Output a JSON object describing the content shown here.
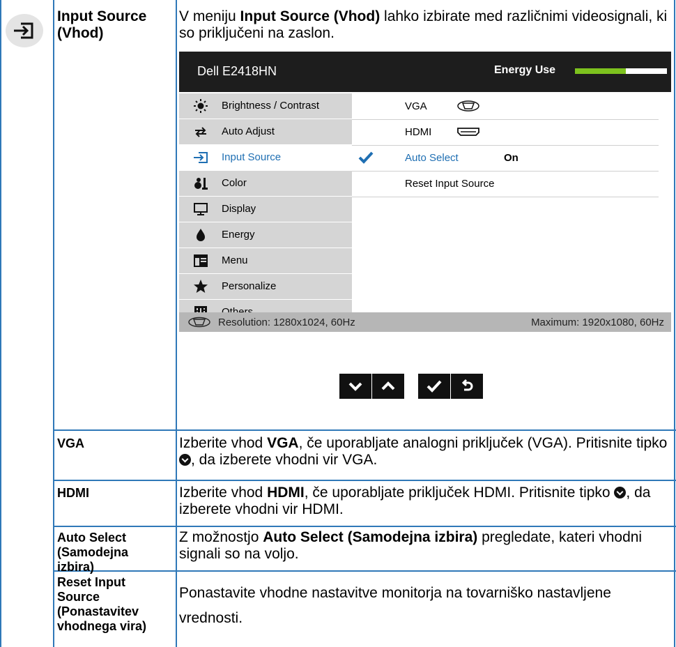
{
  "section": {
    "term_line1": "Input Source",
    "term_line2": "(Vhod)",
    "intro_pre": "V meniju ",
    "intro_bold": "Input Source (Vhod)",
    "intro_post": " lahko izbirate med različnimi videosignali, ki so priključeni na zaslon."
  },
  "osd": {
    "title": "Dell E2418HN",
    "energy_label": "Energy Use",
    "energy_level": 0.55,
    "menu": [
      {
        "label": "Brightness / Contrast",
        "icon": "brightness-icon"
      },
      {
        "label": "Auto Adjust",
        "icon": "auto-adjust-icon"
      },
      {
        "label": "Input Source",
        "icon": "input-source-icon"
      },
      {
        "label": "Color",
        "icon": "color-icon"
      },
      {
        "label": "Display",
        "icon": "display-icon"
      },
      {
        "label": "Energy",
        "icon": "energy-icon"
      },
      {
        "label": "Menu",
        "icon": "menu-icon"
      },
      {
        "label": "Personalize",
        "icon": "star-icon"
      },
      {
        "label": "Others",
        "icon": "others-icon"
      }
    ],
    "active_menu": "Input Source",
    "submenu": [
      {
        "label": "VGA",
        "icon": "vga-connector-icon"
      },
      {
        "label": "HDMI",
        "icon": "hdmi-connector-icon"
      },
      {
        "label": "Auto Select",
        "value": "On",
        "selected": true
      },
      {
        "label": "Reset Input Source"
      }
    ],
    "footer_left": "Resolution: 1280x1024, 60Hz",
    "footer_right": "Maximum: 1920x1080, 60Hz",
    "colors": {
      "accent": "#1f6fb3",
      "energy": "#7dc21e",
      "header": "#1d1d1d"
    }
  },
  "nav_buttons": [
    "chevron-down-icon",
    "chevron-up-icon",
    "check-icon",
    "back-icon"
  ],
  "rows": [
    {
      "term": "VGA",
      "desc_pre": "Izberite vhod ",
      "desc_bold": "VGA",
      "desc_mid": ", če uporabljate analogni priključek (VGA). Pritisnite tipko ",
      "desc_post": ", da izberete vhodni vir VGA."
    },
    {
      "term": "HDMI",
      "desc_pre": "Izberite vhod ",
      "desc_bold": "HDMI",
      "desc_mid": ", če uporabljate priključek HDMI. Pritisnite tipko ",
      "desc_post": ", da izberete vhodni vir HDMI."
    },
    {
      "term_lines": [
        "Auto Select",
        "(Samodejna",
        "izbira)"
      ],
      "desc_pre": "Z možnostjo ",
      "desc_bold": "Auto Select (Samodejna izbira)",
      "desc_post": " pregledate, kateri vhodni signali so na voljo."
    },
    {
      "term_lines": [
        "Reset Input",
        "Source",
        "(Ponastavitev",
        "vhodnega vira)"
      ],
      "desc": "Ponastavite vhodne nastavitve monitorja na tovarniško nastavljene vrednosti."
    }
  ]
}
